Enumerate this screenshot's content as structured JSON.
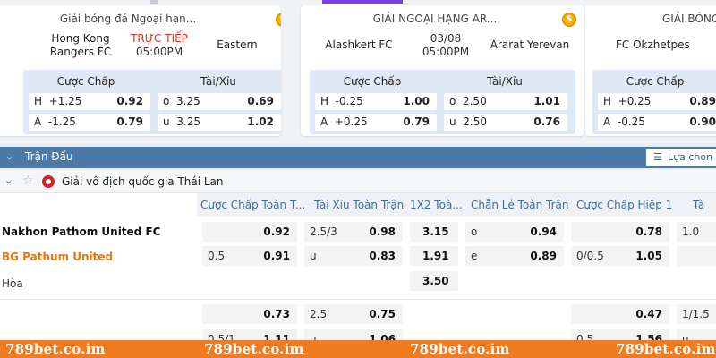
{
  "featured": [
    {
      "league": "Giải bóng đá Ngoại hạn...",
      "home": "Hong Kong Rangers FC",
      "away": "Eastern",
      "status_line1": "TRỰC TIẾP",
      "status_line2": "05:00PM",
      "handicap_label": "Cược Chấp",
      "ou_label": "Tài/Xỉu",
      "handicap": [
        {
          "side": "H",
          "line": "+1.25",
          "odd": "0.92"
        },
        {
          "side": "A",
          "line": "-1.25",
          "odd": "0.79"
        }
      ],
      "ou": [
        {
          "side": "o",
          "line": "3.25",
          "odd": "0.69"
        },
        {
          "side": "u",
          "line": "3.25",
          "odd": "1.02"
        }
      ]
    },
    {
      "league": "GIẢI NGOẠI HẠNG AR...",
      "home": "Alashkert FC",
      "away": "Ararat Yerevan",
      "status_line1": "03/08",
      "status_line2": "05:00PM",
      "handicap_label": "Cược Chấp",
      "ou_label": "Tài/Xỉu",
      "handicap": [
        {
          "side": "H",
          "line": "-0.25",
          "odd": "1.00"
        },
        {
          "side": "A",
          "line": "+0.25",
          "odd": "0.79"
        }
      ],
      "ou": [
        {
          "side": "o",
          "line": "2.50",
          "odd": "1.01"
        },
        {
          "side": "u",
          "line": "2.50",
          "odd": "0.76"
        }
      ]
    },
    {
      "league": "GIẢI BÓNG",
      "home": "FC Okzhetpes",
      "handicap_label": "Cược Chấp",
      "handicap": [
        {
          "side": "H",
          "line": "+0.25",
          "odd": "0.89"
        },
        {
          "side": "A",
          "line": "-0.25",
          "odd": "0.90"
        }
      ]
    }
  ],
  "section": {
    "title": "Trận Đấu",
    "filter_label": "Lựa chọn L"
  },
  "league": {
    "name": "Giải vô địch quốc gia Thái Lan"
  },
  "columns": [
    "Cược Chấp Toàn T...",
    "Tài Xỉu Toàn Trận",
    "1X2 Toà...",
    "Chẵn Lẻ Toàn Trận",
    "Cược Chấp Hiệp 1",
    "Tà"
  ],
  "match": {
    "home": "Nakhon Pathom United FC",
    "away": "BG Pathum United",
    "draw": "Hòa",
    "handicap": [
      {
        "line": "",
        "odd": "0.92"
      },
      {
        "line": "0.5",
        "odd": "0.91"
      }
    ],
    "ou": [
      {
        "line": "2.5/3",
        "odd": "0.98"
      },
      {
        "line": "u",
        "odd": "0.83"
      }
    ],
    "x12": [
      "3.15",
      "1.91",
      "3.50"
    ],
    "oddeven": [
      {
        "line": "o",
        "odd": "0.94"
      },
      {
        "line": "e",
        "odd": "0.89"
      }
    ],
    "h1_handicap": [
      {
        "line": "",
        "odd": "0.78"
      },
      {
        "line": "0/0.5",
        "odd": "1.05"
      }
    ],
    "h1_ou": [
      "1.0",
      ""
    ]
  },
  "match2": {
    "handicap": [
      {
        "line": "",
        "odd": "0.73"
      },
      {
        "line": "0.5/1",
        "odd": "1.11"
      }
    ],
    "ou": [
      {
        "line": "2.5",
        "odd": "0.75"
      },
      {
        "line": "u",
        "odd": "1.06"
      }
    ],
    "h1_handicap": [
      {
        "line": "",
        "odd": "0.47"
      },
      {
        "line": "0.5",
        "odd": "1.56"
      }
    ],
    "h1_ou": [
      "1/1.5",
      "u"
    ]
  },
  "watermark": "789bet.co.im"
}
